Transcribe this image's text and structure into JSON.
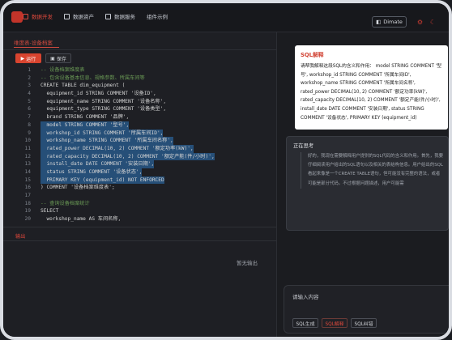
{
  "nav": {
    "items": [
      "数据开发",
      "数据资产",
      "数据服务",
      "组件示例"
    ],
    "theme_button": "Dimate",
    "accent": "#d9463a"
  },
  "tabs": {
    "active": "维度表-设备档案"
  },
  "toolbar": {
    "run": "运行",
    "save": "保存"
  },
  "code_lines": [
    {
      "n": "1",
      "t": "-- 设备档案维度表"
    },
    {
      "n": "2",
      "t": "-- 包含设备基本信息、规格参数、所属车间等"
    },
    {
      "n": "3",
      "t": "CREATE TABLE dim_equipment ("
    },
    {
      "n": "4",
      "t": "  equipment_id STRING COMMENT '设备ID',"
    },
    {
      "n": "5",
      "t": "  equipment_name STRING COMMENT '设备名称',"
    },
    {
      "n": "6",
      "t": "  equipment_type STRING COMMENT '设备类型',"
    },
    {
      "n": "7",
      "t": "  brand STRING COMMENT '品牌',"
    },
    {
      "n": "8",
      "t": "  model STRING COMMENT '型号',"
    },
    {
      "n": "9",
      "t": "  workshop_id STRING COMMENT '所属车间ID',"
    },
    {
      "n": "10",
      "t": "  workshop_name STRING COMMENT '所属车间名称',"
    },
    {
      "n": "11",
      "t": "  rated_power DECIMAL(10, 2) COMMENT '额定功率(kW)',"
    },
    {
      "n": "12",
      "t": "  rated_capacity DECIMAL(10, 2) COMMENT '额定产能(件/小时)',"
    },
    {
      "n": "13",
      "t": "  install_date DATE COMMENT '安装日期',"
    },
    {
      "n": "14",
      "t": "  status STRING COMMENT '设备状态',"
    },
    {
      "n": "15",
      "t": "  PRIMARY KEY (equipment_id) NOT ENFORCED"
    },
    {
      "n": "16",
      "t": ") COMMENT '设备档案维度表';"
    },
    {
      "n": "17",
      "t": ""
    },
    {
      "n": "18",
      "t": "-- 查询设备档案统计"
    },
    {
      "n": "19",
      "t": "SELECT"
    },
    {
      "n": "20",
      "t": "  workshop_name AS 车间名称,"
    }
  ],
  "output": {
    "tab": "输出",
    "empty": "暂无输出"
  },
  "assistant": {
    "card_title": "SQL解释",
    "card_body": "请帮我解释这段SQL的含义和作用：  model STRING COMMENT '型号', workshop_id STRING COMMENT '所属车间ID', workshop_name STRING COMMENT '所属车间名称', rated_power DECIMAL(10, 2) COMMENT '额定功率(kW)', rated_capacity DECIMAL(10, 2) COMMENT '额定产能(件/小时)', install_date DATE COMMENT '安装日期', status STRING COMMENT '设备状态', PRIMARY KEY (equipment_id)",
    "thinking_title": "正在思考",
    "thinking_body": "好的，我现在需要解释用户提供的SQL代码的含义和作用。首先，我要仔细阅读用户给出的SQL语句以及相关的表结构信息。用户给出的SQL看起来像是一个CREATE TABLE语句，但可能没有完整的语法，或者可能是部分代码。不过根据问题描述，用户可能需"
  },
  "input": {
    "placeholder": "请输入内容",
    "chips": [
      "SQL生成",
      "SQL解释",
      "SQL纠错"
    ]
  }
}
